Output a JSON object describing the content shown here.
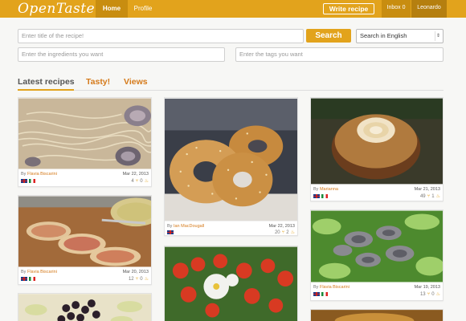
{
  "header": {
    "logo": "OpenTaste",
    "nav_home": "Home",
    "nav_profile": "Profile",
    "write_recipe": "Write recipe",
    "inbox": "Inbox 0",
    "user": "Leonardo"
  },
  "search": {
    "title_placeholder": "Enter title of the recipe!",
    "button": "Search",
    "language": "Search in English",
    "ingredients_placeholder": "Enter the ingredients you want",
    "tags_placeholder": "Enter the tags you want"
  },
  "tabs": [
    "Latest recipes",
    "Tasty!",
    "Views"
  ],
  "colors": {
    "brand": "#e2a31c",
    "brand_dark": "#c88d10",
    "link": "#d57a1a"
  },
  "cards": [
    {
      "by": "By",
      "author": "Flavia Biscarini",
      "date": "Mar 22, 2013",
      "likes": "4",
      "saves": "0",
      "photo": "spaghetti with clams"
    },
    {
      "by": "By",
      "author": "Flavia Biscarini",
      "date": "Mar 20, 2013",
      "likes": "12",
      "saves": "0",
      "photo": "bruschetta with pesto dip"
    },
    {
      "by": "By",
      "author": "Ian MacDougall",
      "date": "Mar 22, 2013",
      "likes": "20",
      "saves": "2",
      "photo": "sesame bagels"
    },
    {
      "by": "By",
      "author": "Marianna",
      "date": "Mar 21, 2013",
      "likes": "49",
      "saves": "1",
      "photo": "powdered sugar cake"
    },
    {
      "by": "By",
      "author": "Flavia Biscarini",
      "date": "Mar 19, 2013",
      "likes": "13",
      "saves": "0",
      "photo": "artichoke salad"
    },
    {
      "by": "",
      "author": "",
      "date": "",
      "likes": "",
      "saves": "",
      "photo": "olives and zucchini"
    },
    {
      "by": "",
      "author": "",
      "date": "",
      "likes": "",
      "saves": "",
      "photo": "cherry tomato salad"
    },
    {
      "by": "",
      "author": "",
      "date": "",
      "likes": "",
      "saves": "",
      "photo": "fried dish"
    }
  ]
}
